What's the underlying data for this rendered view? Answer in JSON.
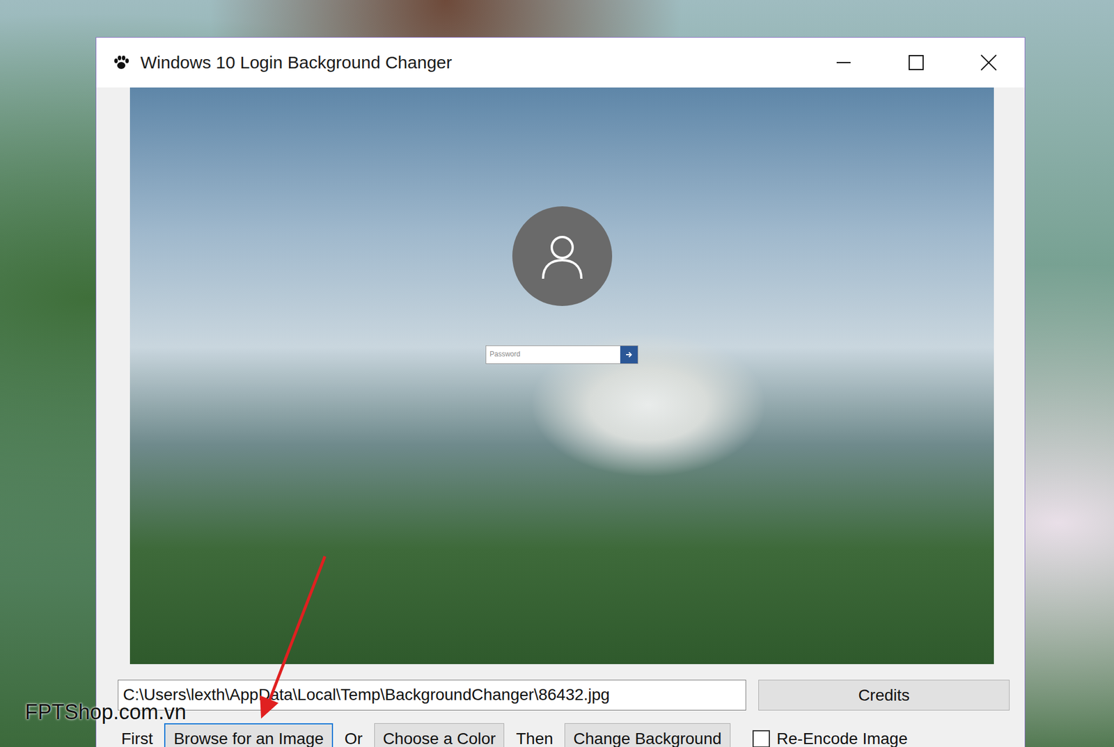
{
  "desktop": {
    "watermark": "FPTShop.com.vn"
  },
  "window": {
    "title": "Windows 10 Login Background Changer"
  },
  "preview": {
    "password_placeholder": "Password"
  },
  "path_field": {
    "value": "C:\\Users\\lexth\\AppData\\Local\\Temp\\BackgroundChanger\\86432.jpg"
  },
  "credits_button": "Credits",
  "steps": [
    {
      "kind": "label",
      "text": "First"
    },
    {
      "kind": "button",
      "text": "Browse for an Image",
      "focused": true
    },
    {
      "kind": "label",
      "text": "Or"
    },
    {
      "kind": "button",
      "text": "Choose a Color",
      "focused": false
    },
    {
      "kind": "label",
      "text": "Then"
    },
    {
      "kind": "button",
      "text": "Change Background",
      "focused": false
    },
    {
      "kind": "checkbox",
      "text": "Re-Encode Image",
      "checked": false
    }
  ]
}
